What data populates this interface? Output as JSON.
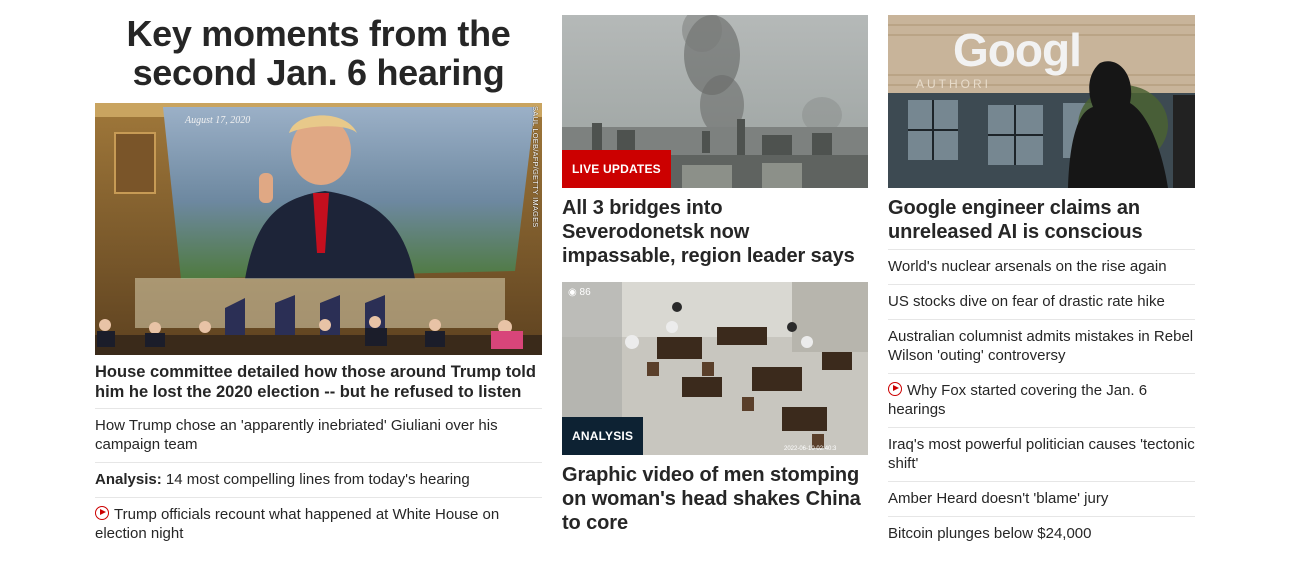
{
  "lead": {
    "title_line1": "Key moments from the",
    "title_line2": "second Jan. 6 hearing",
    "image_credit": "SAUL LOEB/AFP/GETTY IMAGES",
    "image_date_text": "August 17, 2020",
    "headline": "House committee detailed how those around Trump told him he lost the 2020 election -- but he refused to listen",
    "links": [
      {
        "text": "How Trump chose an 'apparently inebriated' Giuliani over his campaign team"
      },
      {
        "prefix": "Analysis:",
        "text": "14 most compelling lines from today's hearing"
      },
      {
        "icon": "play-icon",
        "text": "Trump officials recount what happened at White House on election night"
      }
    ]
  },
  "middle": {
    "card1": {
      "badge": "LIVE UPDATES",
      "headline": "All 3 bridges into Severodonetsk now impassable, region leader says"
    },
    "card2": {
      "badge": "ANALYSIS",
      "headline": "Graphic video of men stomping on woman's head shakes China to core"
    }
  },
  "right": {
    "image_sign_text": "Googl",
    "image_sign_subtext": "AUTHORI",
    "headline": "Google engineer claims an unreleased AI is conscious",
    "links": [
      {
        "text": "World's nuclear arsenals on the rise again"
      },
      {
        "text": "US stocks dive on fear of drastic rate hike"
      },
      {
        "text": "Australian columnist admits mistakes in Rebel Wilson 'outing' controversy"
      },
      {
        "icon": "play-icon",
        "text": "Why Fox started covering the Jan. 6 hearings"
      },
      {
        "text": "Iraq's most powerful politician causes 'tectonic shift'"
      },
      {
        "text": "Amber Heard doesn't 'blame' jury"
      },
      {
        "text": "Bitcoin plunges below $24,000"
      }
    ]
  },
  "colors": {
    "live_badge": "#cc0000",
    "analysis_badge": "#0d2233",
    "play_icon": "#cc0000",
    "divider": "#e6e6e6"
  }
}
